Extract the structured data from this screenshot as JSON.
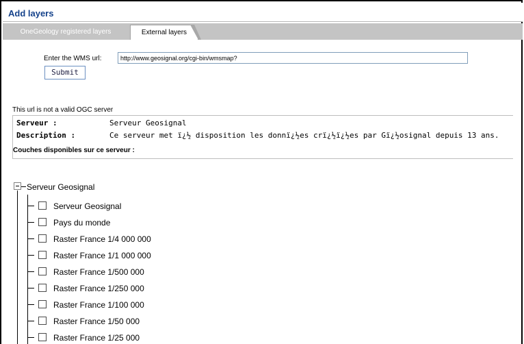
{
  "window": {
    "title": "Add layers"
  },
  "tabs": [
    {
      "label": "OneGeology registered layers",
      "active": false
    },
    {
      "label": "External layers",
      "active": true
    }
  ],
  "wms": {
    "label": "Enter the WMS url:",
    "value": "http://www.geosignal.org/cgi-bin/wmsmap?",
    "submit_label": "Submit"
  },
  "status": {
    "message": "This url is not a valid OGC server"
  },
  "server_info": {
    "serveur_key": "Serveur :",
    "serveur_value": "Serveur Geosignal",
    "description_key": "Description :",
    "description_value": "Ce serveur met ï¿½ disposition les donnï¿½es crï¿½ï¿½es par Gï¿½osignal depuis 13 ans."
  },
  "layers_heading": "Couches disponibles sur ce serveur :",
  "tree": {
    "root_label": "Serveur Geosignal",
    "items": [
      {
        "label": "Serveur Geosignal",
        "checked": false
      },
      {
        "label": "Pays du monde",
        "checked": false
      },
      {
        "label": "Raster France 1/4 000 000",
        "checked": false
      },
      {
        "label": "Raster France 1/1 000 000",
        "checked": false
      },
      {
        "label": "Raster France 1/500 000",
        "checked": false
      },
      {
        "label": "Raster France 1/250 000",
        "checked": false
      },
      {
        "label": "Raster France 1/100 000",
        "checked": false
      },
      {
        "label": "Raster France 1/50 000",
        "checked": false
      },
      {
        "label": "Raster France 1/25 000",
        "checked": false
      }
    ]
  },
  "colors": {
    "title": "#15428b",
    "tab_strip": "#c4c4c4",
    "button_border": "#6b8fc1"
  }
}
